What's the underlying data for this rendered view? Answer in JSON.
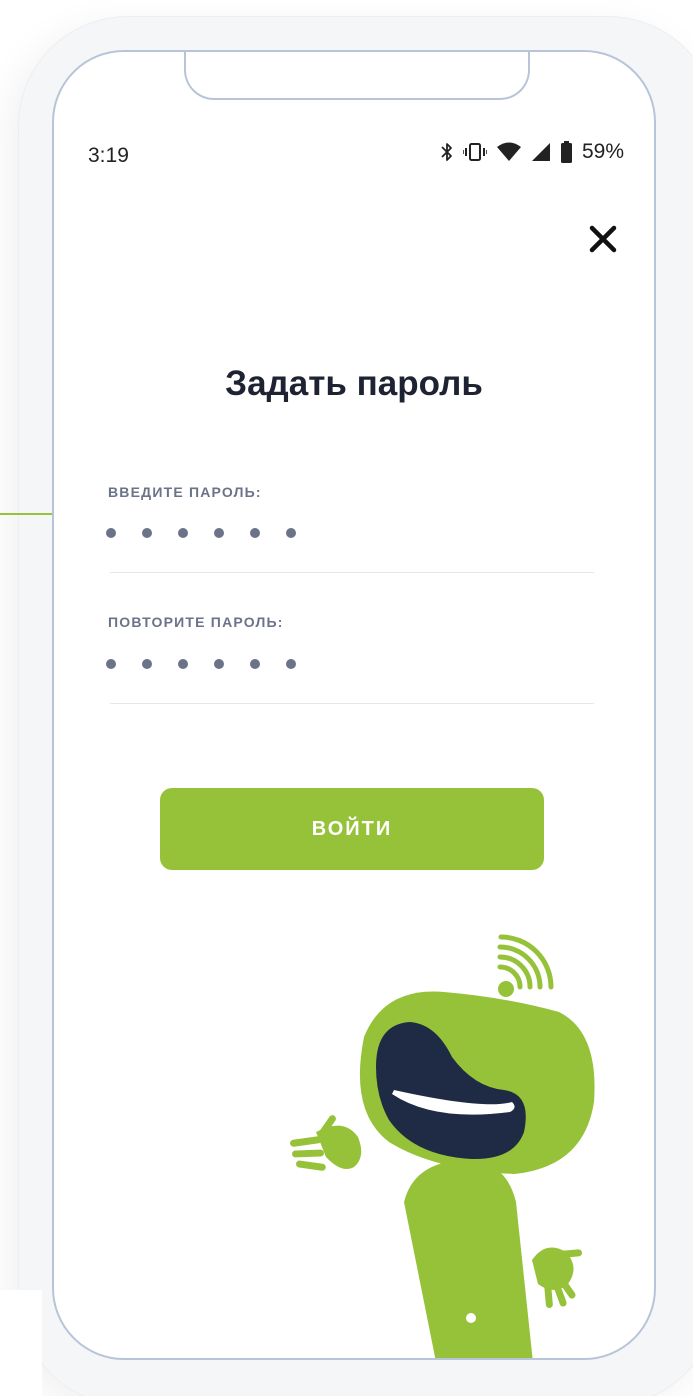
{
  "status_bar": {
    "time": "3:19",
    "battery": "59%",
    "icons": [
      "bluetooth-icon",
      "vibrate-icon",
      "wifi-icon",
      "signal-icon",
      "battery-icon"
    ]
  },
  "header": {
    "close_icon": "close-icon"
  },
  "form": {
    "title": "Задать пароль",
    "password_label": "ВВЕДИТЕ ПАРОЛЬ:",
    "password_dots": 6,
    "repeat_label": "ПОВТОРИТЕ ПАРОЛЬ:",
    "repeat_dots": 6,
    "submit_label": "ВОЙТИ"
  },
  "colors": {
    "accent": "#96c23a",
    "mascot_mouth": "#1f2a44",
    "title": "#1e2333",
    "label": "#6b7388",
    "frame_border": "#b8c4d8"
  }
}
